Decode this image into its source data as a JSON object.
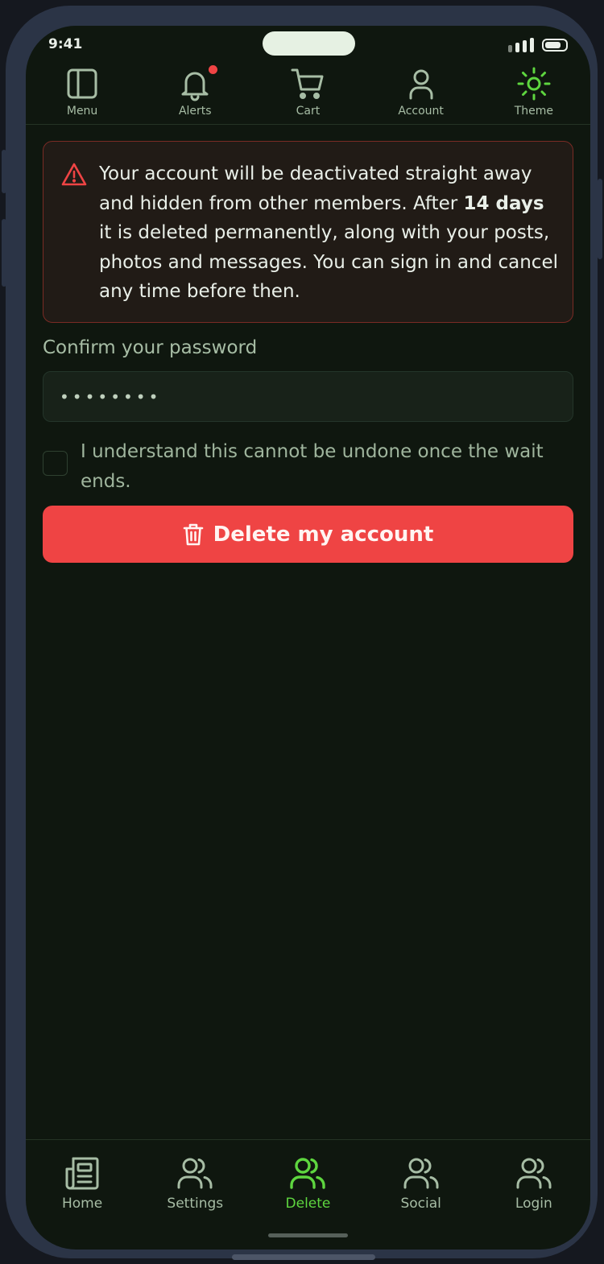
{
  "status_bar": {
    "time": "9:41"
  },
  "top_nav": {
    "items": [
      {
        "label": "Menu",
        "icon": "sidebar-panel-icon"
      },
      {
        "label": "Alerts",
        "icon": "bell-icon",
        "has_badge": true
      },
      {
        "label": "Cart",
        "icon": "cart-icon"
      },
      {
        "label": "Account",
        "icon": "user-icon"
      },
      {
        "label": "Theme",
        "icon": "sun-icon",
        "active": true
      }
    ]
  },
  "warning": {
    "icon": "warning-triangle-icon",
    "text_before": "Your account will be deactivated straight away and hidden from other members. After ",
    "highlight": "14 days",
    "text_after": " it is deleted permanently, along with your posts, photos and messages. You can sign in and cancel any time before then."
  },
  "password": {
    "label": "Confirm your password",
    "value": "••••••••"
  },
  "confirm_checkbox": {
    "checked": false,
    "label": "I understand this cannot be undone once the wait ends."
  },
  "delete_button": {
    "label": "Delete my account",
    "icon": "trash-icon"
  },
  "bottom_nav": {
    "tabs": [
      {
        "label": "Home",
        "icon": "newspaper-icon"
      },
      {
        "label": "Settings",
        "icon": "users-icon"
      },
      {
        "label": "Delete",
        "icon": "users-icon",
        "active": true
      },
      {
        "label": "Social",
        "icon": "users-icon"
      },
      {
        "label": "Login",
        "icon": "users-icon"
      }
    ]
  },
  "colors": {
    "background": "#0f170f",
    "accent_green": "#5ed63f",
    "danger": "#ef4444",
    "muted_text": "#a7bda5"
  }
}
